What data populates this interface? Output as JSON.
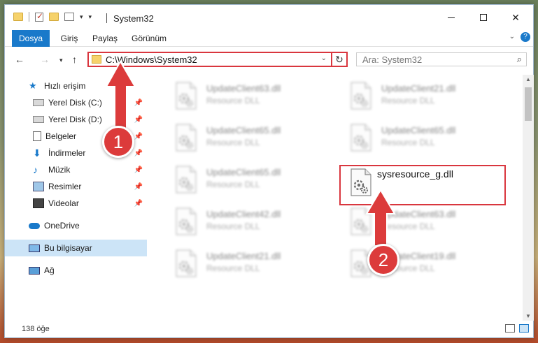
{
  "window": {
    "title": "System32",
    "ribbon_tabs": [
      "Dosya",
      "Giriş",
      "Paylaş",
      "Görünüm"
    ],
    "help_label": "?"
  },
  "address": {
    "path": "C:\\Windows\\System32",
    "search_placeholder": "Ara: System32"
  },
  "sidebar": {
    "items": [
      {
        "label": "Hızlı erişim",
        "icon": "star-icon",
        "pinned": false
      },
      {
        "label": "Yerel Disk (C:)",
        "icon": "drive-icon",
        "pinned": true
      },
      {
        "label": "Yerel Disk (D:)",
        "icon": "drive-icon",
        "pinned": true
      },
      {
        "label": "Belgeler",
        "icon": "documents-icon",
        "pinned": true
      },
      {
        "label": "İndirmeler",
        "icon": "download-icon",
        "pinned": true
      },
      {
        "label": "Müzik",
        "icon": "music-icon",
        "pinned": true
      },
      {
        "label": "Resimler",
        "icon": "pictures-icon",
        "pinned": true
      },
      {
        "label": "Videolar",
        "icon": "videos-icon",
        "pinned": true
      },
      {
        "label": "OneDrive",
        "icon": "cloud-icon",
        "pinned": false
      },
      {
        "label": "Bu bilgisayar",
        "icon": "computer-icon",
        "pinned": false
      },
      {
        "label": "Ağ",
        "icon": "network-icon",
        "pinned": false
      }
    ]
  },
  "files": [
    {
      "name": "UpdateClient63.dll",
      "type": "Resource DLL"
    },
    {
      "name": "UpdateClient21.dll",
      "type": "Resource DLL"
    },
    {
      "name": "UpdateClient65.dll",
      "type": "Resource DLL"
    },
    {
      "name": "UpdateClient65.dll",
      "type": "Resource DLL"
    },
    {
      "name": "UpdateClient65.dll",
      "type": "Resource DLL"
    },
    {
      "name": "sysresource_g.dll",
      "type": ""
    },
    {
      "name": "UpdateClient42.dll",
      "type": "Resource DLL"
    },
    {
      "name": "UpdateClient63.dll",
      "type": "Resource DLL"
    },
    {
      "name": "UpdateClient21.dll",
      "type": "Resource DLL"
    },
    {
      "name": "UpdateClient19.dll",
      "type": "Resource DLL"
    }
  ],
  "status": {
    "item_count": "138 öğe"
  },
  "annotations": {
    "step1": "1",
    "step2": "2",
    "color": "#dc3b3b"
  }
}
